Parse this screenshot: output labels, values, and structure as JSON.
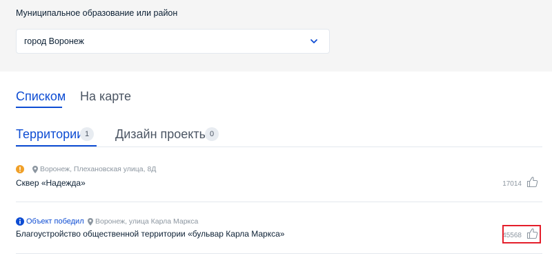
{
  "filter": {
    "label": "Муниципальное образование или район",
    "selected": "город Воронеж",
    "icon": "chevron-down-icon"
  },
  "view_tabs": [
    {
      "label": "Списком",
      "active": true
    },
    {
      "label": "На карте",
      "active": false
    }
  ],
  "category_tabs": [
    {
      "label": "Территории",
      "count": "1",
      "active": true
    },
    {
      "label": "Дизайн проекты",
      "count": "0",
      "active": false
    }
  ],
  "items": [
    {
      "status_icon": "info-orange-icon",
      "status_text": "",
      "address": "Воронеж, Плехановская улица, 8Д",
      "title": "Сквер «Надежда»",
      "votes": "17014",
      "like_icon": "thumbs-up-icon"
    },
    {
      "status_icon": "info-blue-icon",
      "status_text": "Объект победил",
      "address": "Воронеж, улица Карла Маркса",
      "title": "Благоустройство общественной территории «бульвар Карла Маркса»",
      "votes": "45568",
      "like_icon": "thumbs-up-icon"
    }
  ],
  "colors": {
    "accent": "#0d4cd3",
    "warning": "#f0a028",
    "highlight": "#e41d2a",
    "panel_bg": "#f5f5f5"
  }
}
